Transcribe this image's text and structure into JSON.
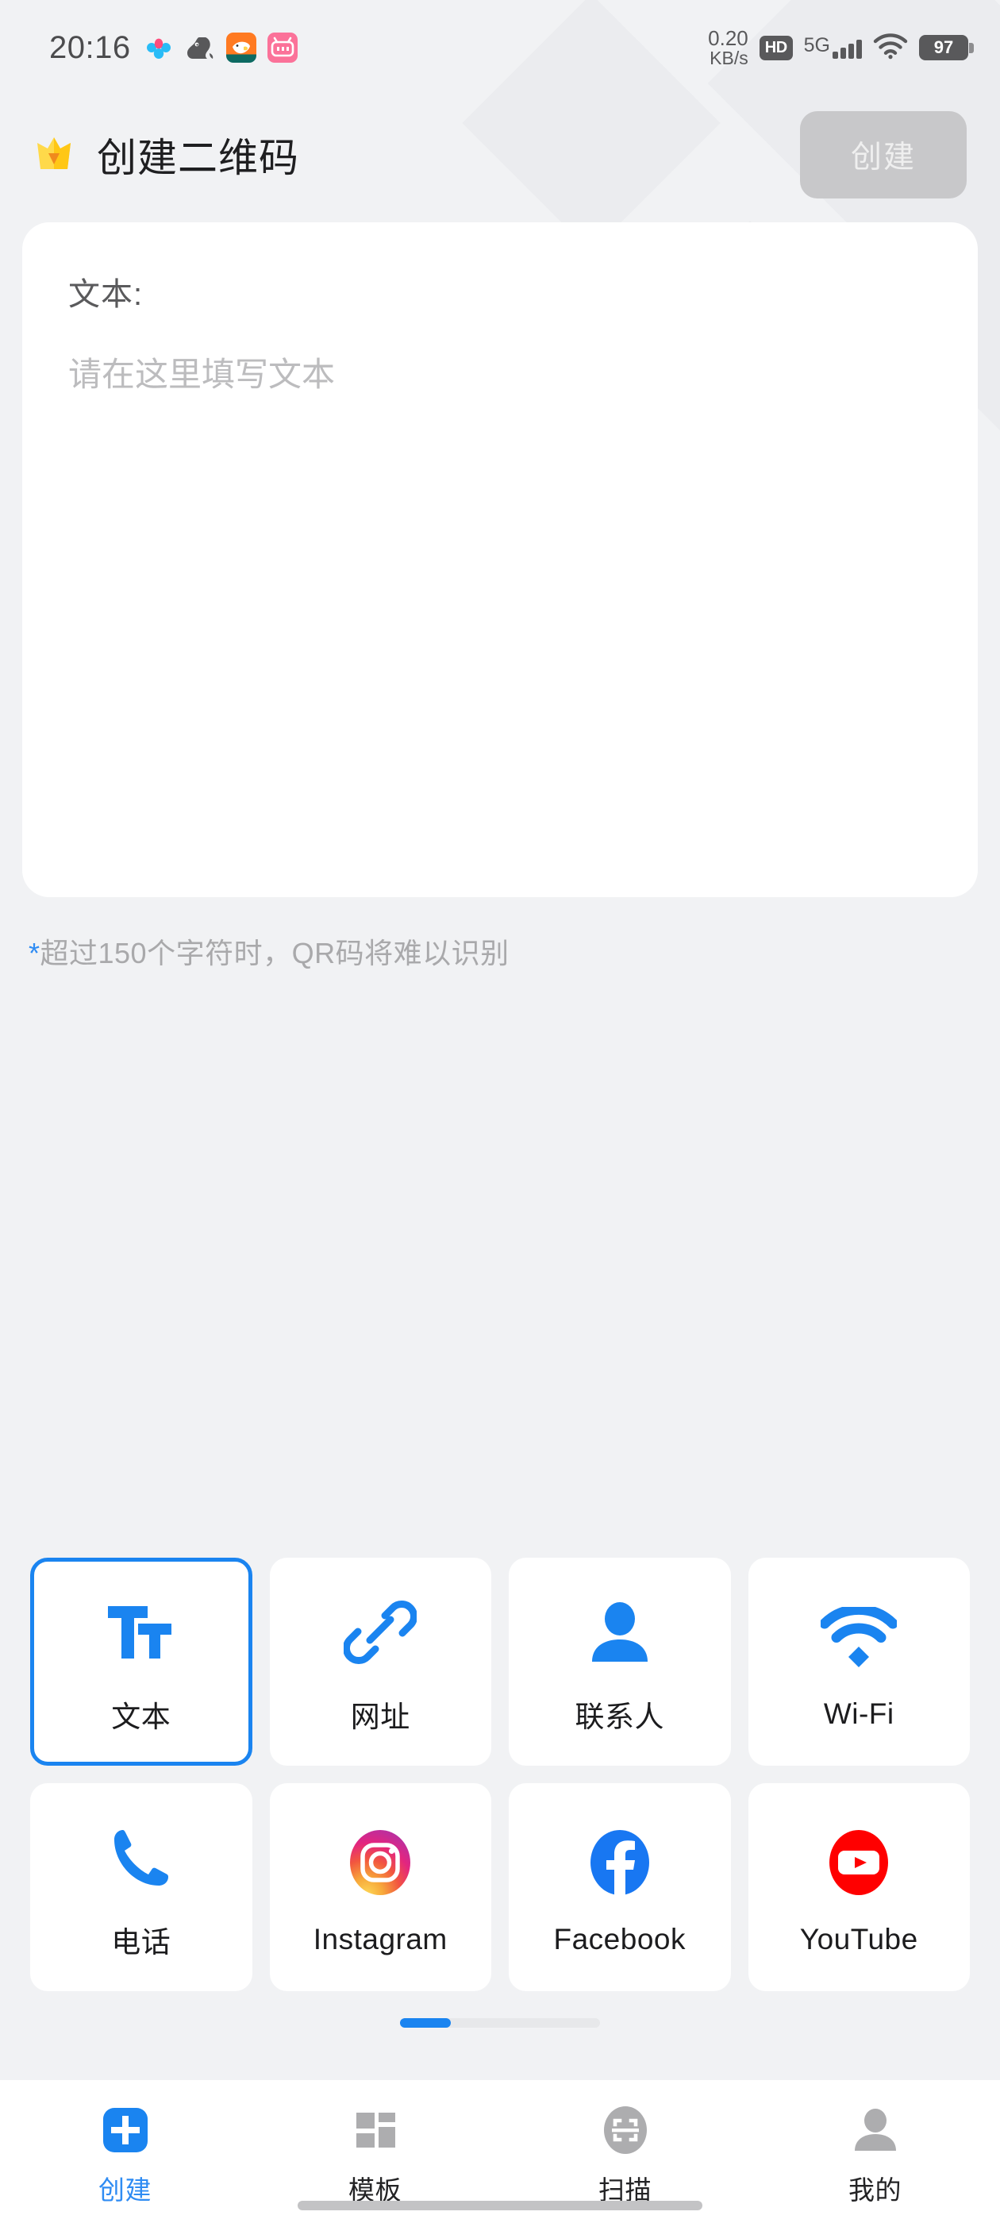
{
  "status_bar": {
    "time": "20:16",
    "app_icons": [
      "baidu-netdisk-icon",
      "squirrel-app-icon",
      "xianyu-app-icon",
      "bilibili-app-icon"
    ],
    "net_speed_value": "0.20",
    "net_speed_unit": "KB/s",
    "hd_label": "HD",
    "network_type": "5G",
    "signal_bars": 4,
    "wifi": "wifi-icon",
    "battery_percent": "97"
  },
  "header": {
    "vip_icon": "crown-vip-icon",
    "title": "创建二维码",
    "create_button": {
      "label": "创建",
      "enabled": false,
      "bg": "#c8c8ca",
      "fg": "#efefef"
    }
  },
  "text_card": {
    "label": "文本:",
    "value": "",
    "placeholder": "请在这里填写文本"
  },
  "hint": {
    "marker": "*",
    "marker_color": "#2f8cf3",
    "text": "超过150个字符时，QR码将难以识别"
  },
  "type_grid": {
    "selected_index": 0,
    "selected_color": "#1a84f0",
    "tiles": [
      {
        "label": "文本",
        "icon": "text-format-icon",
        "icon_color": "#1a84f0"
      },
      {
        "label": "网址",
        "icon": "link-icon",
        "icon_color": "#1a84f0"
      },
      {
        "label": "联系人",
        "icon": "person-icon",
        "icon_color": "#1a84f0"
      },
      {
        "label": "Wi-Fi",
        "icon": "wifi-icon",
        "icon_color": "#1a84f0"
      },
      {
        "label": "电话",
        "icon": "phone-icon",
        "icon_color": "#1a84f0"
      },
      {
        "label": "Instagram",
        "icon": "instagram-icon",
        "icon_color": "#e1306c"
      },
      {
        "label": "Facebook",
        "icon": "facebook-icon",
        "icon_color": "#1877f2"
      },
      {
        "label": "YouTube",
        "icon": "youtube-icon",
        "icon_color": "#ff0000"
      }
    ]
  },
  "page_indicator": {
    "pages": 4,
    "current": 1,
    "active_color": "#1a84f0",
    "track_color": "#e7e8ea"
  },
  "bottom_nav": {
    "active_index": 0,
    "active_color": "#2f8cf3",
    "items": [
      {
        "label": "创建",
        "icon": "plus-square-icon"
      },
      {
        "label": "模板",
        "icon": "grid-template-icon"
      },
      {
        "label": "扫描",
        "icon": "scan-qr-icon"
      },
      {
        "label": "我的",
        "icon": "person-icon"
      }
    ]
  }
}
